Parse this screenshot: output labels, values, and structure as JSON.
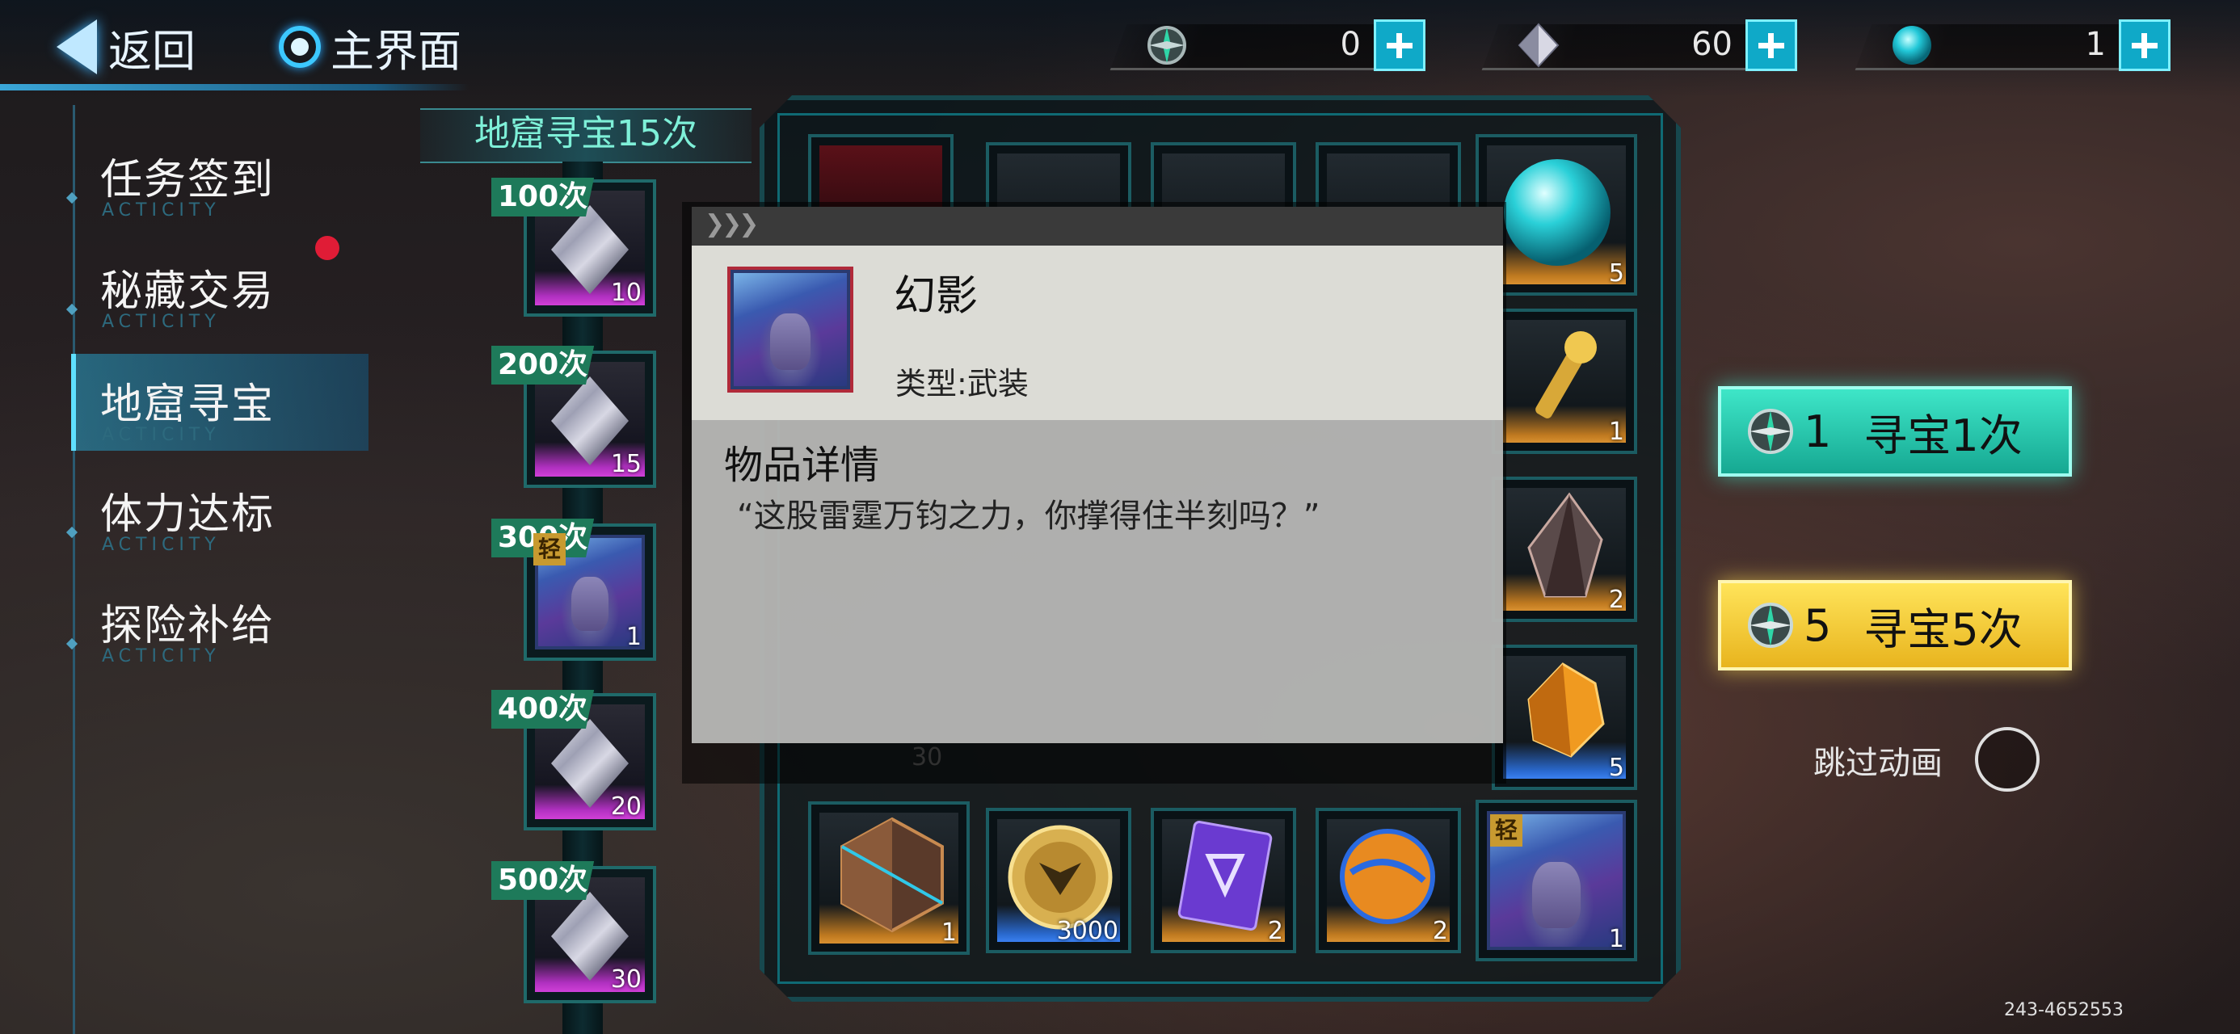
{
  "nav": {
    "back_label": "返回",
    "home_label": "主界面"
  },
  "currencies": [
    {
      "icon": "compass-icon",
      "value": "0"
    },
    {
      "icon": "crystal-icon",
      "value": "60"
    },
    {
      "icon": "orb-icon",
      "value": "1"
    }
  ],
  "menu": {
    "items": [
      {
        "label": "任务签到",
        "sub": "ACTICITY"
      },
      {
        "label": "秘藏交易",
        "sub": "ACTICITY"
      },
      {
        "label": "地窟寻宝",
        "sub": "ACTICITY"
      },
      {
        "label": "体力达标",
        "sub": "ACTICITY"
      },
      {
        "label": "探险补给",
        "sub": "ACTICITY"
      }
    ],
    "active_index": 2
  },
  "milestones": {
    "title": "地窟寻宝15次",
    "items": [
      {
        "tag": "100次",
        "count": "10",
        "item": "crystal"
      },
      {
        "tag": "200次",
        "count": "15",
        "item": "crystal"
      },
      {
        "tag": "300次",
        "count": "1",
        "item": "portrait",
        "badge": "轻"
      },
      {
        "tag": "400次",
        "count": "20",
        "item": "crystal"
      },
      {
        "tag": "500次",
        "count": "30",
        "item": "crystal"
      }
    ]
  },
  "grid": {
    "visible_counts": {
      "top_right": "5",
      "r2_right": "1",
      "r3_right": "2",
      "r4_right": "5",
      "r4_left": "30"
    },
    "bottom_row": [
      {
        "name": "armor-orb",
        "count": "1"
      },
      {
        "name": "gold-coin",
        "count": "3000"
      },
      {
        "name": "purple-card",
        "count": "2"
      },
      {
        "name": "energy-sphere",
        "count": "2"
      },
      {
        "name": "portrait",
        "count": "1",
        "badge": "轻"
      }
    ]
  },
  "popup": {
    "name": "幻影",
    "type_label": "类型",
    "type_value": "武装",
    "detail_title": "物品详情",
    "description": "“这股雷霆万钧之力，你撑得住半刻吗？”"
  },
  "actions": {
    "hunt_once": {
      "cost": "1",
      "label": "寻宝1次"
    },
    "hunt_five": {
      "cost": "5",
      "label": "寻宝5次"
    },
    "skip_label": "跳过动画"
  },
  "uid": "243-4652553",
  "colors": {
    "accent_cyan": "#3ee6c8",
    "accent_yellow": "#ffd83a",
    "frame_teal": "#17484e",
    "notify_red": "#e01c36"
  }
}
